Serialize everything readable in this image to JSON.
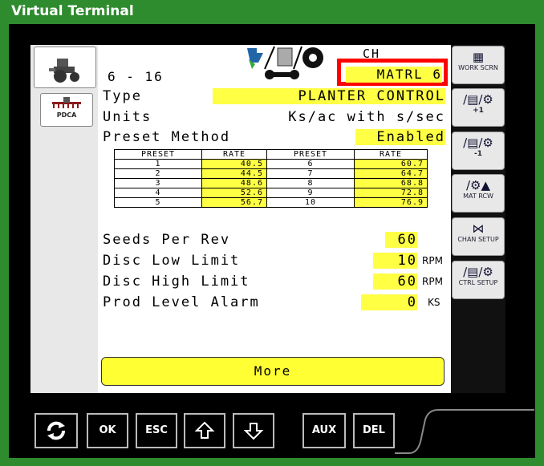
{
  "window": {
    "title": "Virtual Terminal"
  },
  "header": {
    "page_number": "6 - 16",
    "ch_label": "CH",
    "material": "MATRL 6"
  },
  "left_tabs": [
    {
      "icon": "tractor-icon"
    },
    {
      "icon": "pdca-icon",
      "label": "PDCA"
    }
  ],
  "fields": {
    "type_label": "Type",
    "type_value": "PLANTER CONTROL",
    "units_label": "Units",
    "units_value": "Ks/ac with s/sec",
    "preset_method_label": "Preset Method",
    "preset_method_value": "Enabled"
  },
  "preset_table": {
    "headers": [
      "PRESET",
      "RATE",
      "PRESET",
      "RATE"
    ],
    "rows": [
      [
        "1",
        "40.5",
        "6",
        "60.7"
      ],
      [
        "2",
        "44.5",
        "7",
        "64.7"
      ],
      [
        "3",
        "48.6",
        "8",
        "68.8"
      ],
      [
        "4",
        "52.6",
        "9",
        "72.8"
      ],
      [
        "5",
        "56.7",
        "10",
        "76.9"
      ]
    ]
  },
  "settings": {
    "seeds_per_rev_label": "Seeds Per Rev",
    "seeds_per_rev_value": "60",
    "disc_low_label": "Disc Low Limit",
    "disc_low_value": "10",
    "disc_low_unit": "RPM",
    "disc_high_label": "Disc High Limit",
    "disc_high_value": "60",
    "disc_high_unit": "RPM",
    "prod_level_label": "Prod Level Alarm",
    "prod_level_value": "0",
    "prod_level_unit": "KS"
  },
  "more_button": "More",
  "right_buttons": [
    {
      "icon": "work-screen-icon",
      "label": "WORK SCRN"
    },
    {
      "icon": "material-plus-icon",
      "label": "+1"
    },
    {
      "icon": "material-minus-icon",
      "label": "-1"
    },
    {
      "icon": "material-row-icon",
      "label": "MAT RCW"
    },
    {
      "icon": "channel-setup-icon",
      "label": "CHAN SETUP"
    },
    {
      "icon": "control-setup-icon",
      "label": "CTRL SETUP"
    }
  ],
  "bottom_bar": {
    "refresh": "refresh-icon",
    "ok": "OK",
    "esc": "ESC",
    "up": "up-arrow-icon",
    "down": "down-arrow-icon",
    "aux": "AUX",
    "del": "DEL"
  },
  "colors": {
    "frame": "#2e8b2e",
    "highlight": "#ffff44",
    "alert_border": "#ff0000"
  }
}
